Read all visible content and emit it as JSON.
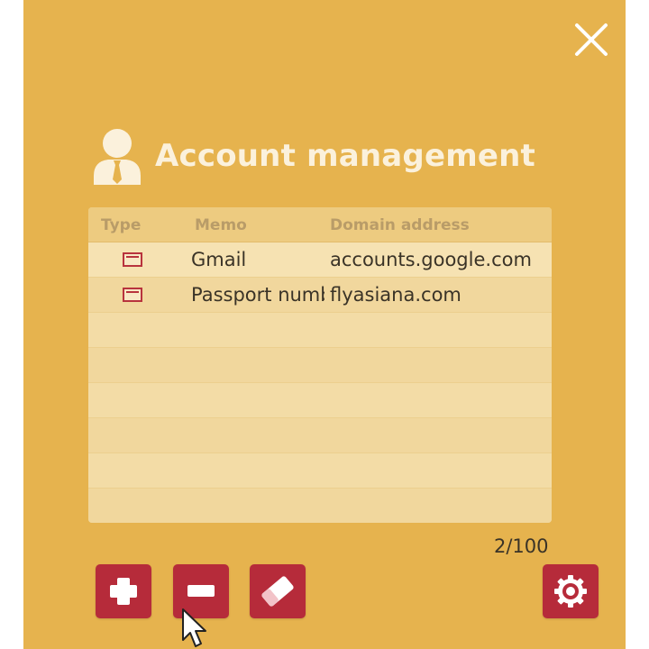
{
  "window": {
    "title": "Account management",
    "close_icon": "close-icon",
    "background_color": "#e6b34e",
    "accent_color": "#b62b3a"
  },
  "table": {
    "columns": [
      "Type",
      "Memo",
      "Domain address"
    ],
    "rows": [
      {
        "type_icon": "card-icon",
        "memo": "Gmail",
        "domain": "accounts.google.com"
      },
      {
        "type_icon": "card-icon",
        "memo": "Passport number",
        "domain": "flyasiana.com"
      }
    ]
  },
  "count": "2/100",
  "toolbar": {
    "add_icon": "plus-icon",
    "remove_icon": "minus-icon",
    "erase_icon": "eraser-icon",
    "settings_icon": "gear-icon"
  }
}
